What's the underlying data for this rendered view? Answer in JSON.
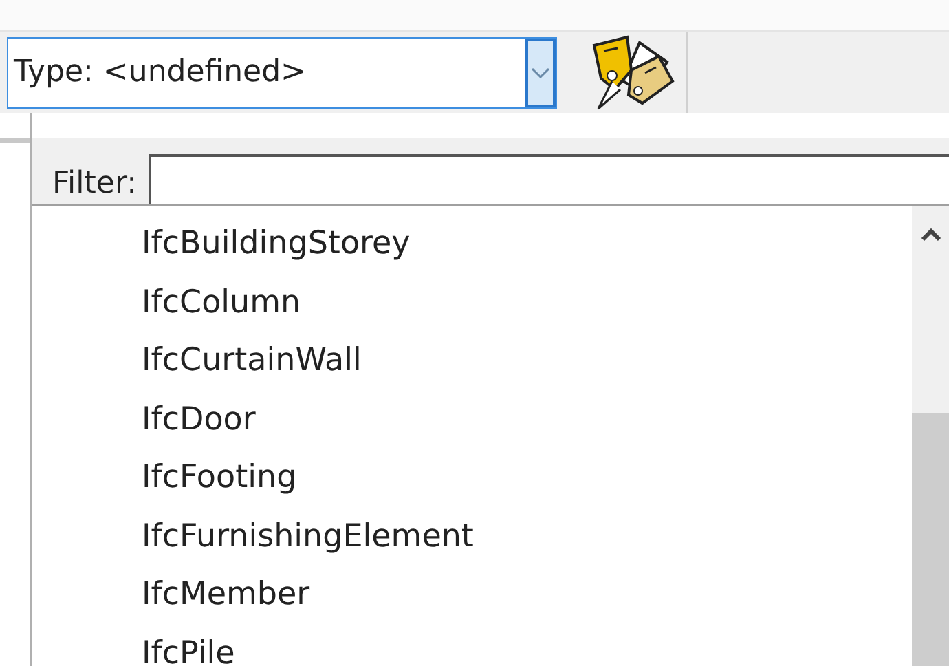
{
  "type_combo": {
    "value": "Type: <undefined>"
  },
  "type_popup": {
    "filter": {
      "label": "Filter:"
    },
    "items": [
      {
        "label": "IfcBuildingStorey",
        "selected": false
      },
      {
        "label": "IfcColumn",
        "selected": false
      },
      {
        "label": "IfcCurtainWall",
        "selected": false
      },
      {
        "label": "IfcDoor",
        "selected": false
      },
      {
        "label": "IfcFooting",
        "selected": false
      },
      {
        "label": "IfcFurnishingElement",
        "selected": false
      },
      {
        "label": "IfcMember",
        "selected": false
      },
      {
        "label": "IfcPile",
        "selected": false
      }
    ]
  }
}
